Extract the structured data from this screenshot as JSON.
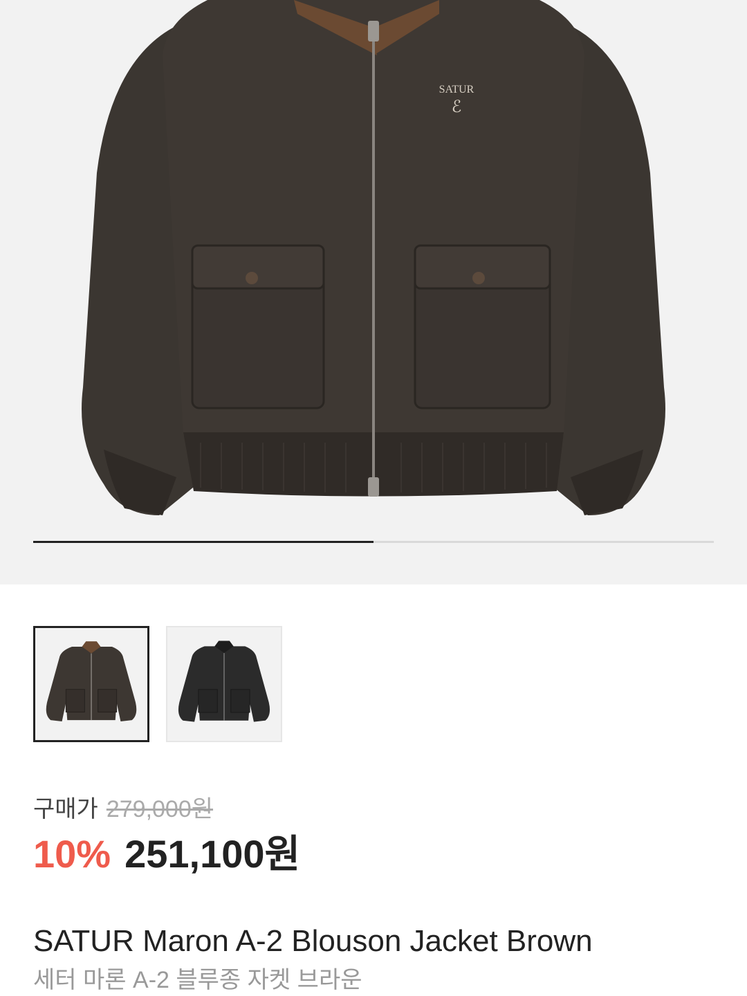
{
  "gallery": {
    "main_image": {
      "alt": "SATUR Maron A-2 Blouson Jacket Brown",
      "logo_text": "SATUR",
      "colors": {
        "body": "#3b3631",
        "collar": "#6b4a32",
        "background": "#f2f2f2"
      }
    },
    "progress": {
      "current": 1,
      "total": 2
    },
    "thumbnails": [
      {
        "name": "Brown",
        "selected": true,
        "body": "#3d3732",
        "collar": "#6b4a32"
      },
      {
        "name": "Black",
        "selected": false,
        "body": "#2b2b2b",
        "collar": "#1d1d1d"
      }
    ]
  },
  "price": {
    "label": "구매가",
    "original": "279,000원",
    "discount": "10%",
    "sale": "251,100원",
    "discount_color": "#ef5b4c"
  },
  "product": {
    "name": "SATUR Maron A-2 Blouson Jacket Brown",
    "name_kr": "세터 마론 A-2 블루종 자켓 브라운"
  }
}
